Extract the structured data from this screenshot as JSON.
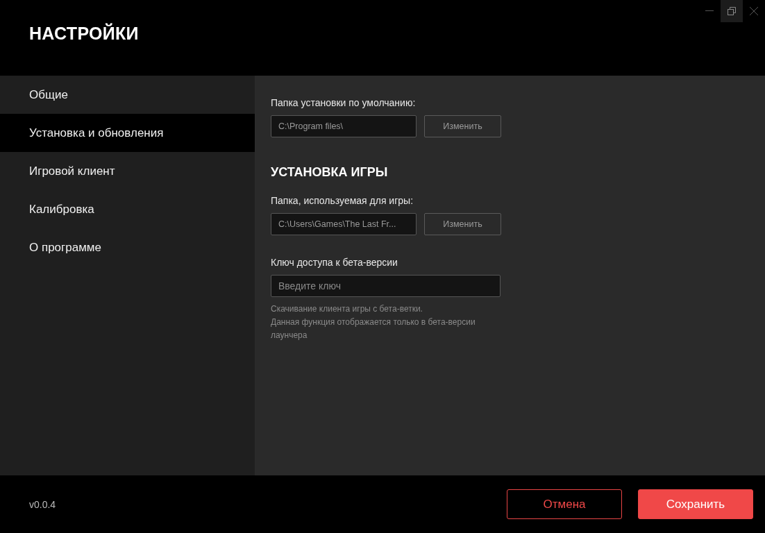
{
  "window": {
    "title": "НАСТРОЙКИ",
    "controls": [
      {
        "kind": "minimize",
        "selected": false
      },
      {
        "kind": "restore",
        "selected": true
      },
      {
        "kind": "close",
        "selected": false
      }
    ]
  },
  "sidebar": {
    "items": [
      {
        "label": "Общие",
        "selected": false
      },
      {
        "label": "Установка и обновления",
        "selected": true
      },
      {
        "label": "Игровой клиент",
        "selected": false
      },
      {
        "label": "Калибровка",
        "selected": false
      },
      {
        "label": "О программе",
        "selected": false
      }
    ]
  },
  "content": {
    "default_folder": {
      "label": "Папка установки по умолчанию:",
      "value": "C:\\Program files\\",
      "button": "Изменить"
    },
    "section_title": "УСТАНОВКА ИГРЫ",
    "game_folder": {
      "label": "Папка, используемая для игры:",
      "value": "C:\\Users\\Games\\The Last Fr...",
      "button": "Изменить"
    },
    "beta_key": {
      "label": "Ключ доступа к бета-версии",
      "placeholder": "Введите ключ",
      "hint": [
        "Скачивание клиента игры с бета-ветки.",
        "Данная функция отображается только в бета-версии лаунчера"
      ]
    }
  },
  "footer": {
    "version": "v0.0.4",
    "buttons": [
      {
        "label": "Отмена",
        "kind": "secondary"
      },
      {
        "label": "Сохранить",
        "kind": "primary"
      }
    ]
  }
}
